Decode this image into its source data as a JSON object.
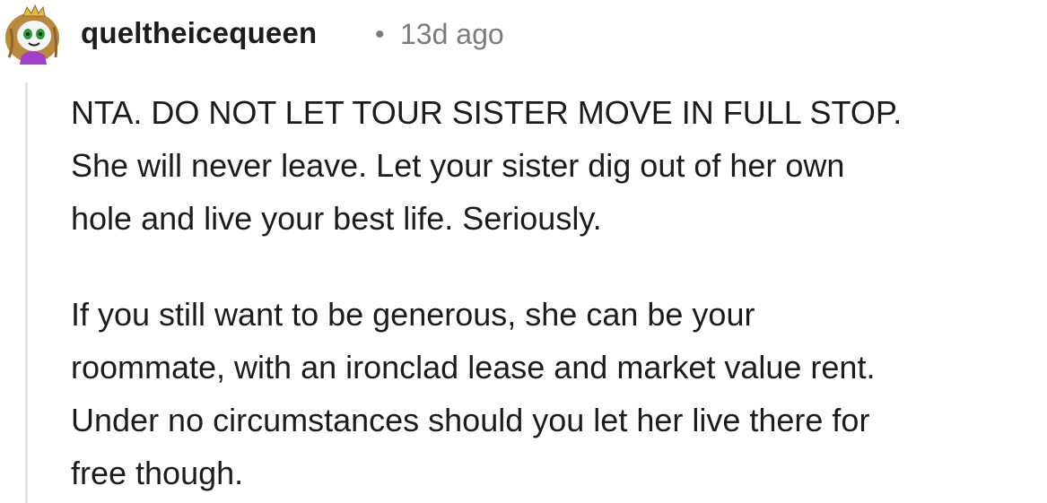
{
  "comment": {
    "author": "queltheicequeen",
    "separator": "•",
    "timestamp": "13d ago",
    "avatar_icon": "cartoon-queen-avatar-icon",
    "paragraphs": [
      "NTA. DO NOT LET TOUR SISTER MOVE IN FULL STOP.\nShe will never leave. Let your sister dig out of her own\nhole and live your best life. Seriously.",
      "If you still want to be generous, she can be your\nroommate, with an ironclad lease and market value rent.\nUnder no circumstances should you let her live there for\nfree though."
    ]
  },
  "colors": {
    "text": "#1c1c1c",
    "meta": "#7c7c7c",
    "thread_line": "#e5e5e5"
  }
}
